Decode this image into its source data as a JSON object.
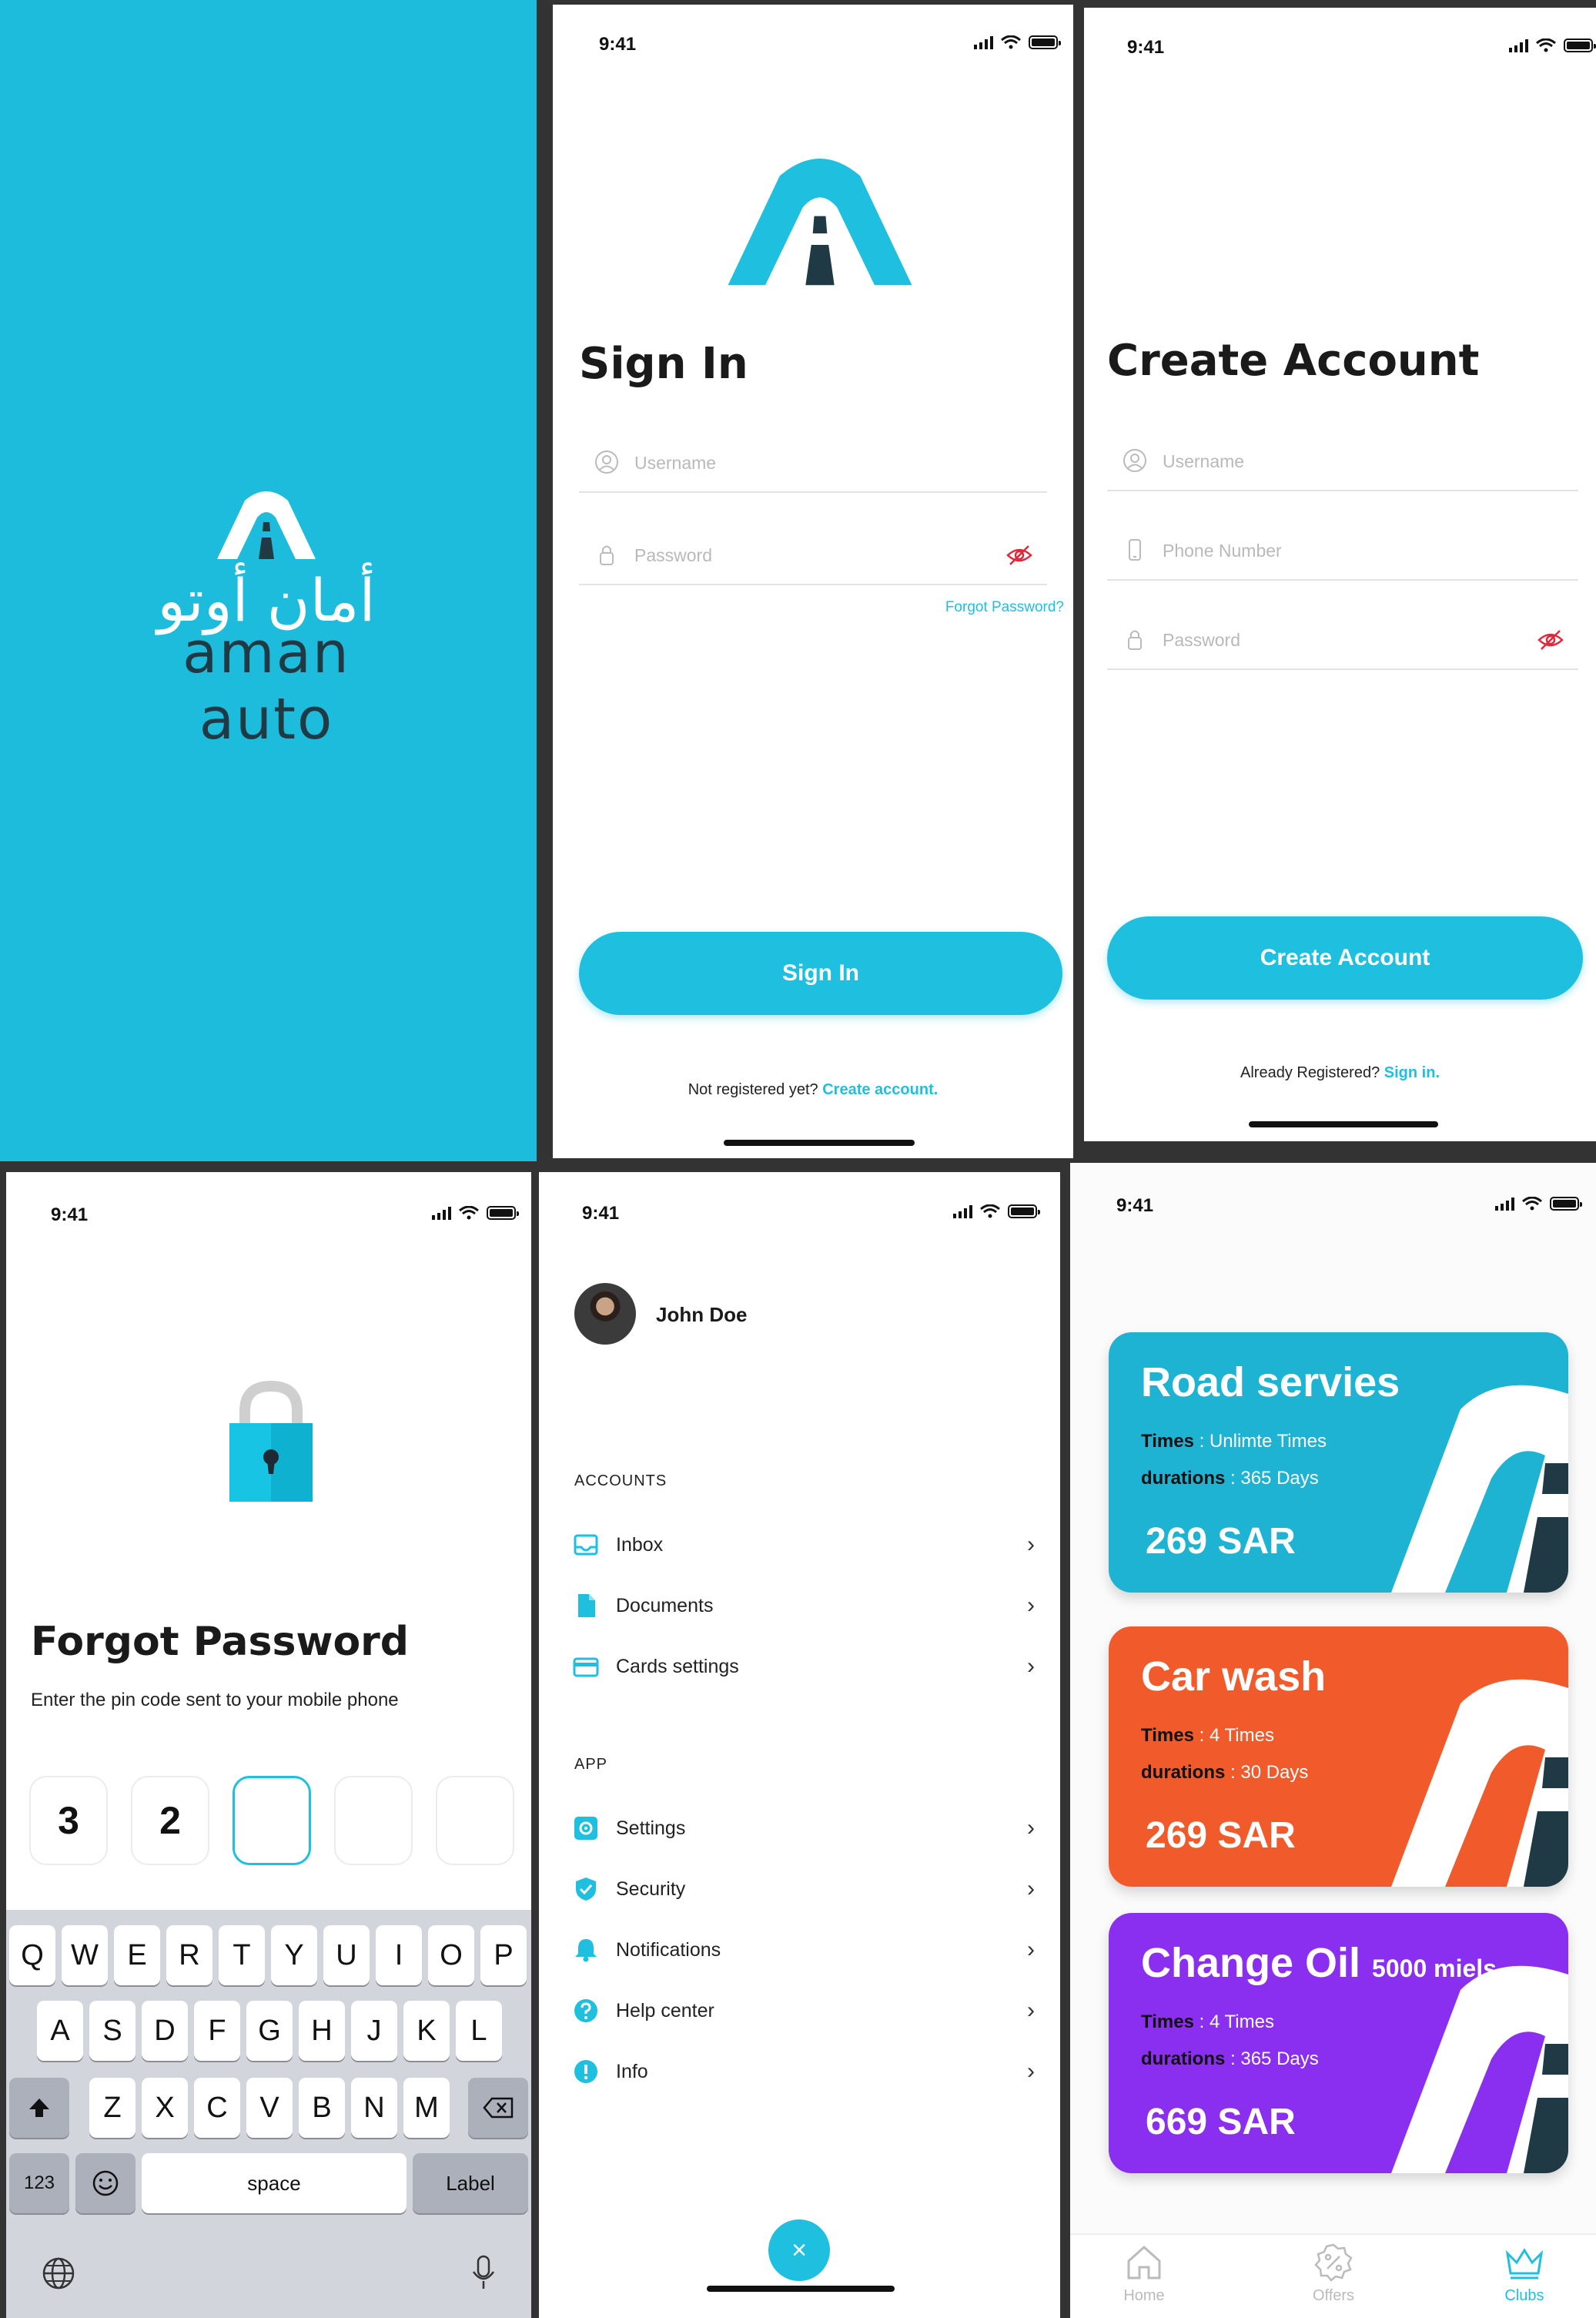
{
  "status": {
    "time": "9:41"
  },
  "splash": {
    "arabic_name": "أمان أوتو",
    "brand_name": "aman auto"
  },
  "signin": {
    "title": "Sign In",
    "username_placeholder": "Username",
    "password_placeholder": "Password",
    "forgot_link": "Forgot Password?",
    "button": "Sign In",
    "footer_text": "Not registered yet?",
    "footer_link": "Create account."
  },
  "create": {
    "title": "Create Account",
    "username_placeholder": "Username",
    "phone_placeholder": "Phone Number",
    "password_placeholder": "Password",
    "button": "Create Account",
    "footer_text": "Already Registered?",
    "footer_link": "Sign in."
  },
  "forgot": {
    "title": "Forgot Password",
    "subtitle": "Enter the pin code sent to your mobile phone",
    "pins": [
      "3",
      "2",
      "",
      "",
      ""
    ],
    "keyboard": {
      "row1": [
        "Q",
        "W",
        "E",
        "R",
        "T",
        "Y",
        "U",
        "I",
        "O",
        "P"
      ],
      "row2": [
        "A",
        "S",
        "D",
        "F",
        "G",
        "H",
        "J",
        "K",
        "L"
      ],
      "row3": [
        "Z",
        "X",
        "C",
        "V",
        "B",
        "N",
        "M"
      ],
      "numbers": "123",
      "space": "space",
      "return": "Label"
    }
  },
  "menu": {
    "user_name": "John Doe",
    "accounts_heading": "ACCOUNTS",
    "accounts": [
      {
        "label": "Inbox",
        "icon": "inbox-icon"
      },
      {
        "label": "Documents",
        "icon": "document-icon"
      },
      {
        "label": "Cards settings",
        "icon": "card-icon"
      }
    ],
    "app_heading": "APP",
    "app": [
      {
        "label": "Settings",
        "icon": "settings-icon"
      },
      {
        "label": "Security",
        "icon": "shield-icon"
      },
      {
        "label": "Notifications",
        "icon": "bell-icon"
      },
      {
        "label": "Help center",
        "icon": "help-icon"
      },
      {
        "label": "Info",
        "icon": "info-icon"
      }
    ],
    "close_symbol": "×"
  },
  "clubs": {
    "cards": [
      {
        "title": "Road servies",
        "title_suffix": "",
        "times_label": "Times",
        "times_value": ": Unlimte Times",
        "dur_label": "durations",
        "dur_value": ": 365 Days",
        "price": "269 SAR",
        "color": "#1eb3d2"
      },
      {
        "title": "Car wash",
        "title_suffix": "",
        "times_label": "Times",
        "times_value": ": 4 Times",
        "dur_label": "durations",
        "dur_value": ": 30 Days",
        "price": "269 SAR",
        "color": "#f15a2b"
      },
      {
        "title": "Change Oil",
        "title_suffix": "5000 miels",
        "times_label": "Times",
        "times_value": ": 4 Times",
        "dur_label": "durations",
        "dur_value": ": 365 Days",
        "price": "669 SAR",
        "color": "#8a2ff0"
      }
    ],
    "tabs": [
      {
        "label": "Home",
        "icon": "home-icon"
      },
      {
        "label": "Offers",
        "icon": "offers-icon"
      },
      {
        "label": "Clubs",
        "icon": "crown-icon"
      }
    ],
    "accent": "#1fbfdf"
  }
}
